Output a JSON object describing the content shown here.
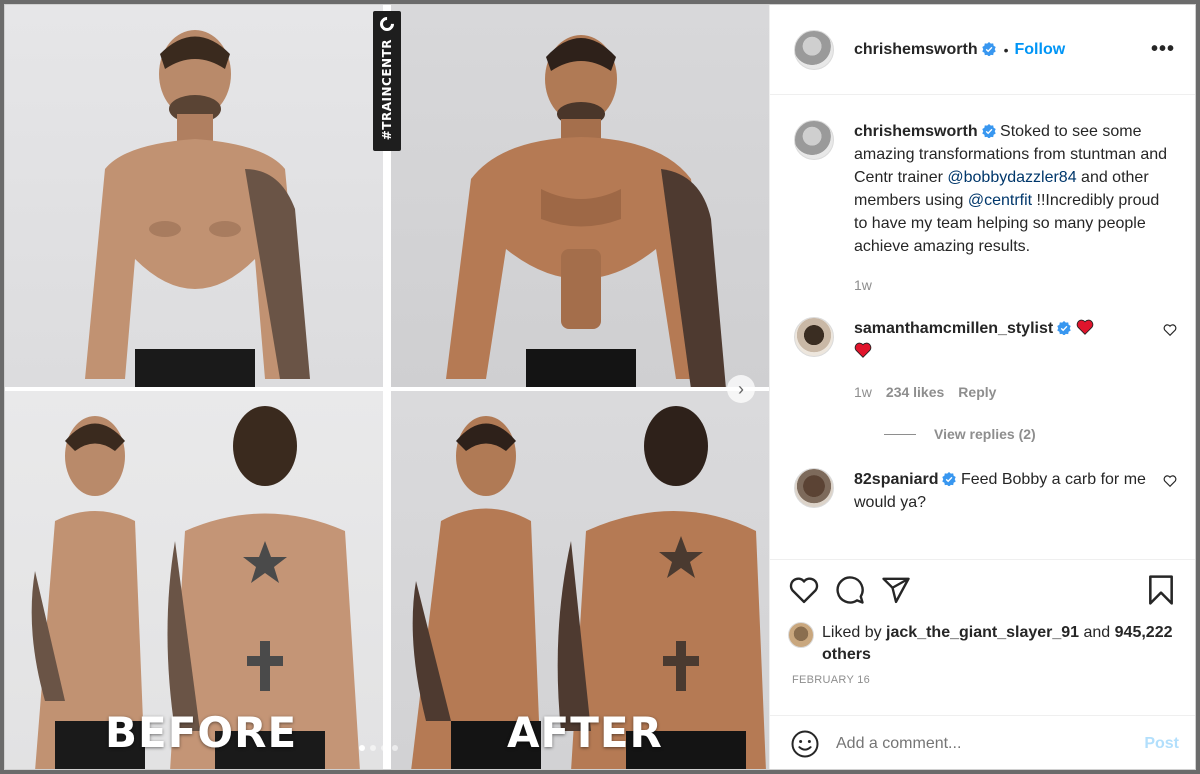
{
  "post": {
    "author": "chrishemsworth",
    "follow_label": "Follow",
    "separator": "•",
    "more_label": "•••"
  },
  "media": {
    "tag_text": "#TRAINCENTR",
    "before_label": "BEFORE",
    "after_label": "AFTER",
    "next_arrow": "›"
  },
  "caption": {
    "author": "chrishemsworth",
    "text_part1": "Stoked to see some amazing transformations from stuntman and Centr trainer ",
    "mention1": "@bobbydazzler84",
    "text_part2": " and other members using ",
    "mention2": "@centrfit",
    "text_part3": " !!Incredibly proud to have my team helping so many people achieve amazing results.",
    "time": "1w"
  },
  "comments": [
    {
      "author": "samanthamcmillen_stylist",
      "time": "1w",
      "likes": "234 likes",
      "reply_label": "Reply",
      "view_replies": "View replies (2)"
    },
    {
      "author": "82spaniard",
      "text": "Feed Bobby a carb for me would ya?"
    }
  ],
  "likes": {
    "prefix": "Liked by ",
    "user": "jack_the_giant_slayer_91",
    "middle": " and ",
    "others": "945,222 others"
  },
  "date": "FEBRUARY 16",
  "add_comment": {
    "placeholder": "Add a comment...",
    "post_label": "Post"
  },
  "colors": {
    "accent": "#0095f6",
    "verified": "#3897f0",
    "heart": "#ed4956",
    "post_disabled": "#b2dffc"
  },
  "icons": [
    "verified-badge-icon",
    "heart-icon",
    "comment-icon",
    "share-icon",
    "save-icon",
    "emoji-icon",
    "more-icon",
    "chevron-right-icon"
  ]
}
